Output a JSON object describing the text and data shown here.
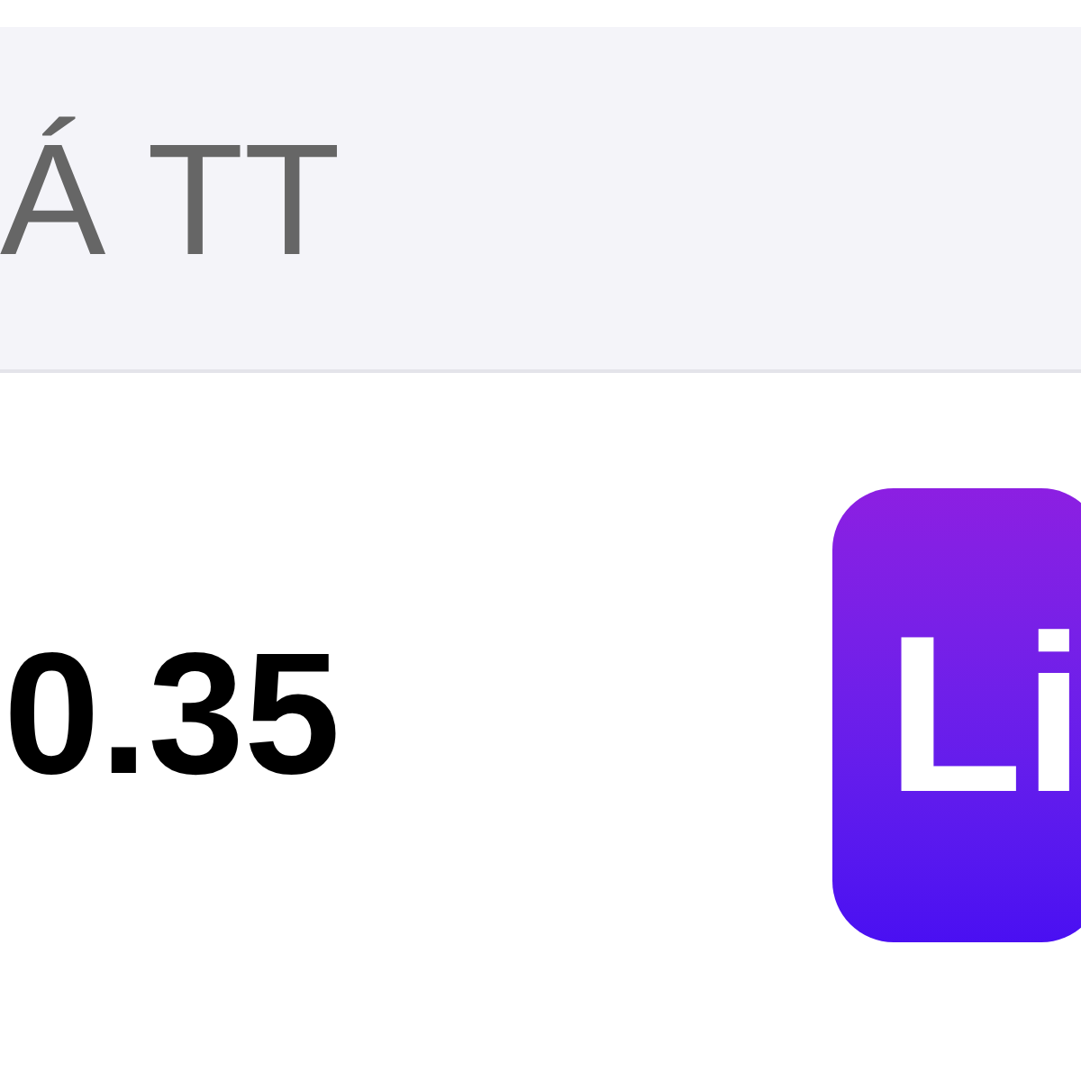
{
  "header": {
    "title": "Á TT"
  },
  "row": {
    "value": "0.35",
    "badge": "Li"
  }
}
